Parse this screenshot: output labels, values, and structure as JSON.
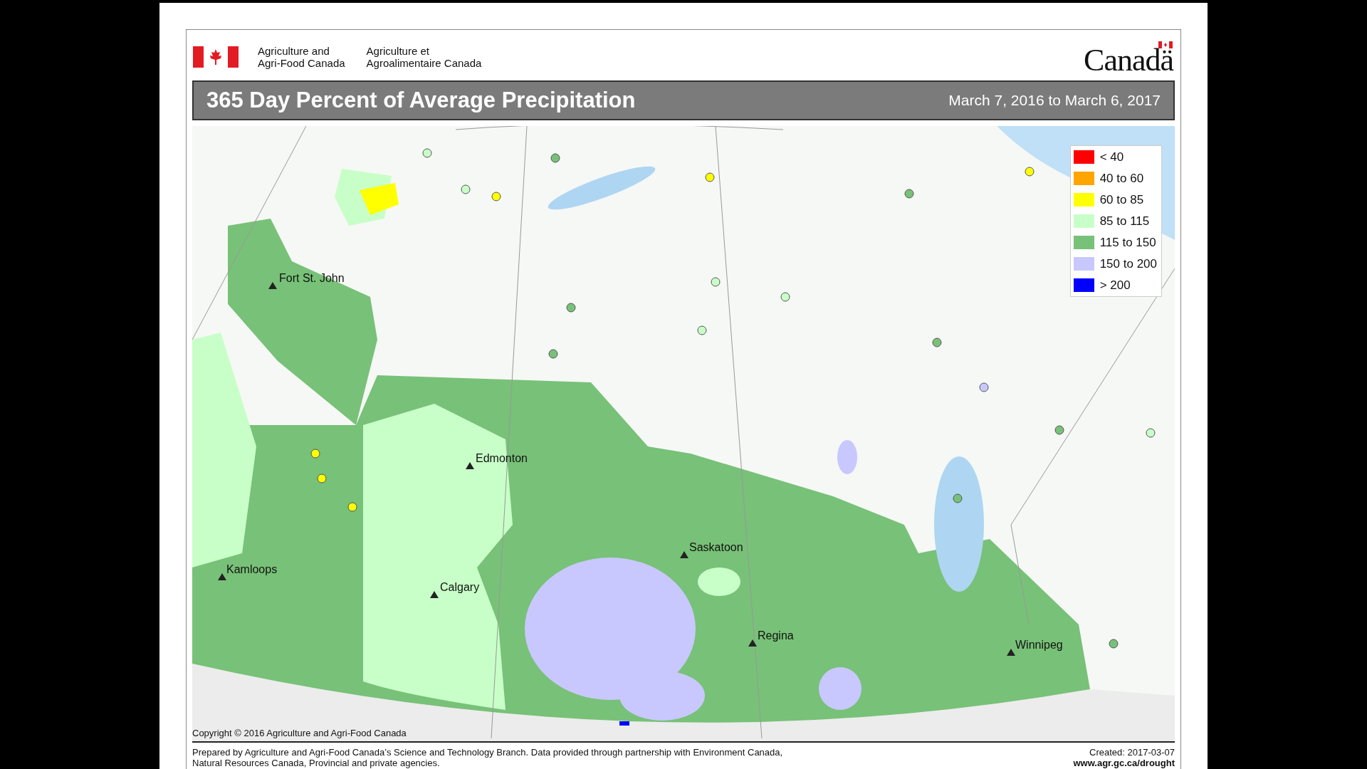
{
  "header": {
    "department_en": "Agriculture and\nAgri-Food Canada",
    "department_fr": "Agriculture et\nAgroalimentaire Canada",
    "wordmark": "Canadä"
  },
  "title_bar": {
    "title": "365 Day Percent of Average Precipitation",
    "date_range": "March 7, 2016 to March 6, 2017"
  },
  "map": {
    "cities": [
      {
        "name": "Fort St. John"
      },
      {
        "name": "Edmonton"
      },
      {
        "name": "Saskatoon"
      },
      {
        "name": "Calgary"
      },
      {
        "name": "Kamloops"
      },
      {
        "name": "Regina"
      },
      {
        "name": "Winnipeg"
      }
    ],
    "legend": [
      {
        "label": "< 40",
        "color": "#ff0000"
      },
      {
        "label": "40 to 60",
        "color": "#ffa500"
      },
      {
        "label": "60 to 85",
        "color": "#ffff00"
      },
      {
        "label": "85 to 115",
        "color": "#c8ffc8"
      },
      {
        "label": "115 to 150",
        "color": "#78c178"
      },
      {
        "label": "150 to 200",
        "color": "#c8c8ff"
      },
      {
        "label": "> 200",
        "color": "#0000ff"
      }
    ],
    "copyright": "Copyright © 2016 Agriculture and Agri-Food Canada"
  },
  "footer": {
    "credit": "Prepared by Agriculture and Agri-Food Canada’s Science and Technology Branch. Data provided through partnership with Environment Canada,\nNatural Resources Canada, Provincial and private agencies.",
    "created": "Created: 2017-03-07",
    "website": "www.agr.gc.ca/drought"
  }
}
